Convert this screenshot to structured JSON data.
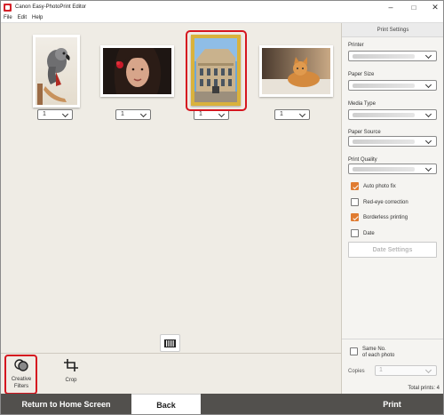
{
  "window": {
    "title": "Canon Easy-PhotoPrint Editor",
    "controls": {
      "minimize": "–",
      "maximize": "□",
      "close": "✕"
    }
  },
  "menu": [
    "File",
    "Edit",
    "Help"
  ],
  "photos": [
    {
      "subject": "parrot",
      "quantity": "1",
      "selected": false
    },
    {
      "subject": "woman",
      "quantity": "1",
      "selected": false
    },
    {
      "subject": "building",
      "quantity": "1",
      "selected": true
    },
    {
      "subject": "cat",
      "quantity": "1",
      "selected": false
    }
  ],
  "tools": {
    "creative_filters": "Creative\nFilters",
    "crop": "Crop"
  },
  "footer": {
    "home": "Return to Home Screen",
    "back": "Back",
    "print": "Print"
  },
  "panel": {
    "title": "Print Settings",
    "printer_label": "Printer",
    "paper_size_label": "Paper Size",
    "media_type_label": "Media Type",
    "paper_source_label": "Paper Source",
    "print_quality_label": "Print Quality",
    "auto_photo_fix": {
      "label": "Auto photo fix",
      "checked": true
    },
    "red_eye": {
      "label": "Red-eye correction",
      "checked": false
    },
    "borderless": {
      "label": "Borderless printing",
      "checked": true
    },
    "date": {
      "label": "Date",
      "checked": false
    },
    "date_settings": "Date Settings",
    "same_no_line1": "Same No.",
    "same_no_line2": "of each photo",
    "copies_label": "Copies",
    "copies_value": "1",
    "total_prints": "Total prints: 4"
  },
  "colors": {
    "accent": "#e07b30",
    "highlight": "#d5161f",
    "footer": "#52504d"
  }
}
